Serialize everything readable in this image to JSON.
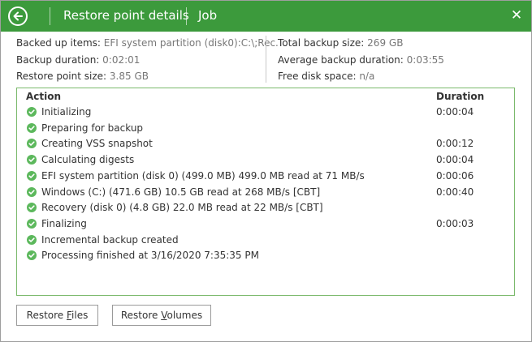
{
  "titlebar": {
    "title": "Restore point details",
    "subtitle": "Job",
    "close_glyph": "✕",
    "accent_color": "#3c9a3c"
  },
  "summary": {
    "backed_up_items": {
      "label": "Backed up items:",
      "value": "EFI system partition (disk0):C:\\;Rec."
    },
    "backup_duration": {
      "label": "Backup duration:",
      "value": "0:02:01"
    },
    "restore_point_size": {
      "label": "Restore point size:",
      "value": "3.85 GB"
    },
    "total_backup_size": {
      "label": "Total backup size:",
      "value": "269 GB"
    },
    "average_backup_duration": {
      "label": "Average backup duration:",
      "value": "0:03:55"
    },
    "free_disk_space": {
      "label": "Free disk space:",
      "value": "n/a"
    }
  },
  "log": {
    "col_action": "Action",
    "col_duration": "Duration",
    "status_color": "#5cb85c",
    "rows": [
      {
        "icon": "success-check-icon",
        "action": "Initializing",
        "duration": "0:00:04"
      },
      {
        "icon": "success-check-icon",
        "action": "Preparing for backup",
        "duration": ""
      },
      {
        "icon": "success-check-icon",
        "action": "Creating VSS snapshot",
        "duration": "0:00:12"
      },
      {
        "icon": "success-check-icon",
        "action": "Calculating digests",
        "duration": "0:00:04"
      },
      {
        "icon": "success-check-icon",
        "action": "EFI system partition (disk 0) (499.0 MB) 499.0 MB read at 71 MB/s",
        "duration": "0:00:06"
      },
      {
        "icon": "success-check-icon",
        "action": "Windows (C:) (471.6 GB) 10.5 GB read at 268 MB/s [CBT]",
        "duration": "0:00:40"
      },
      {
        "icon": "success-check-icon",
        "action": "Recovery (disk 0) (4.8 GB) 22.0 MB read at 22 MB/s [CBT]",
        "duration": ""
      },
      {
        "icon": "success-check-icon",
        "action": "Finalizing",
        "duration": "0:00:03"
      },
      {
        "icon": "success-check-icon",
        "action": "Incremental backup created",
        "duration": ""
      },
      {
        "icon": "success-check-icon",
        "action": "Processing finished at 3/16/2020 7:35:35 PM",
        "duration": ""
      }
    ]
  },
  "buttons": {
    "restore_files": {
      "before": "Restore ",
      "mnemonic": "F",
      "after": "iles"
    },
    "restore_volumes": {
      "before": "Restore ",
      "mnemonic": "V",
      "after": "olumes"
    }
  }
}
